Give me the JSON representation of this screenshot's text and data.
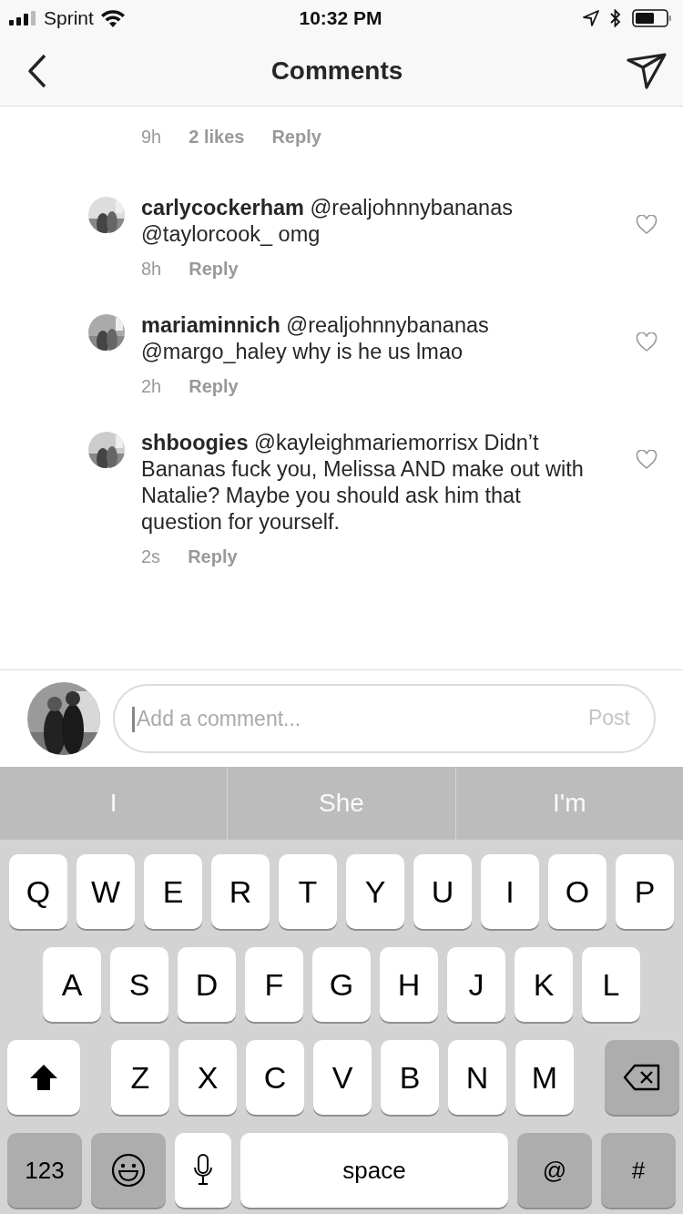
{
  "status_bar": {
    "carrier": "Sprint",
    "time": "10:32 PM"
  },
  "header": {
    "title": "Comments"
  },
  "comments": [
    {
      "kind": "tail",
      "time": "9h",
      "likes": "2 likes",
      "reply": "Reply"
    },
    {
      "kind": "reply",
      "username": "carlycockerham",
      "text": "@realjohnnybananas @taylorcook_ omg",
      "time": "8h",
      "reply": "Reply"
    },
    {
      "kind": "reply",
      "username": "mariaminnich",
      "text": "@realjohnnybananas @margo_haley why is he us lmao",
      "time": "2h",
      "reply": "Reply"
    },
    {
      "kind": "reply",
      "username": "shboogies",
      "text": "@kayleighmariemorrisx Didn’t Bananas fuck you, Melissa AND make out with Natalie? Maybe you should ask him that question for yourself.",
      "time": "2s",
      "reply": "Reply"
    }
  ],
  "composer": {
    "placeholder": "Add a comment...",
    "post": "Post"
  },
  "keyboard": {
    "suggestions": [
      "I",
      "She",
      "I'm"
    ],
    "rows": [
      {
        "keys": [
          {
            "kind": "letter",
            "label": "Q"
          },
          {
            "kind": "letter",
            "label": "W"
          },
          {
            "kind": "letter",
            "label": "E"
          },
          {
            "kind": "letter",
            "label": "R"
          },
          {
            "kind": "letter",
            "label": "T"
          },
          {
            "kind": "letter",
            "label": "Y"
          },
          {
            "kind": "letter",
            "label": "U"
          },
          {
            "kind": "letter",
            "label": "I"
          },
          {
            "kind": "letter",
            "label": "O"
          },
          {
            "kind": "letter",
            "label": "P"
          }
        ]
      },
      {
        "keys": [
          {
            "kind": "letter",
            "label": "A"
          },
          {
            "kind": "letter",
            "label": "S"
          },
          {
            "kind": "letter",
            "label": "D"
          },
          {
            "kind": "letter",
            "label": "F"
          },
          {
            "kind": "letter",
            "label": "G"
          },
          {
            "kind": "letter",
            "label": "H"
          },
          {
            "kind": "letter",
            "label": "J"
          },
          {
            "kind": "letter",
            "label": "K"
          },
          {
            "kind": "letter",
            "label": "L"
          }
        ]
      },
      {
        "keys": [
          {
            "kind": "shift"
          },
          {
            "kind": "letter",
            "label": "Z"
          },
          {
            "kind": "letter",
            "label": "X"
          },
          {
            "kind": "letter",
            "label": "C"
          },
          {
            "kind": "letter",
            "label": "V"
          },
          {
            "kind": "letter",
            "label": "B"
          },
          {
            "kind": "letter",
            "label": "N"
          },
          {
            "kind": "letter",
            "label": "M"
          },
          {
            "kind": "delete"
          }
        ]
      },
      {
        "keys": [
          {
            "kind": "mode",
            "label": "123"
          },
          {
            "kind": "emoji"
          },
          {
            "kind": "mic"
          },
          {
            "kind": "space",
            "label": "space"
          },
          {
            "kind": "symbol",
            "label": "@"
          },
          {
            "kind": "symbol",
            "label": "#"
          }
        ]
      }
    ]
  }
}
